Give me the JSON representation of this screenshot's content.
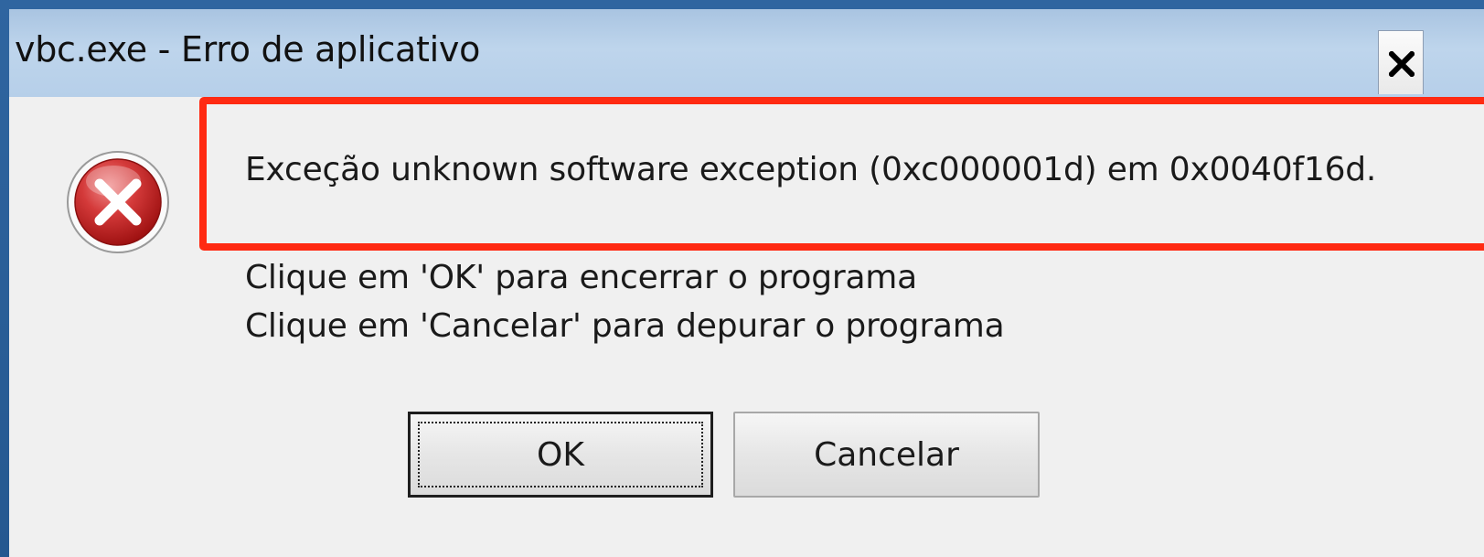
{
  "window": {
    "title": "vbc.exe - Erro de aplicativo",
    "close_glyph": "close-icon"
  },
  "message": {
    "icon": "error-icon",
    "main": "Exceção unknown software exception (0xc000001d) em 0x0040f16d.",
    "line1": "Clique em 'OK' para encerrar o programa",
    "line2": "Clique em 'Cancelar' para depurar o programa"
  },
  "buttons": {
    "ok": "OK",
    "cancel": "Cancelar"
  },
  "colors": {
    "highlight": "#ff2a12",
    "titlebar": "#b6cfe9",
    "error_red": "#c41e1e",
    "desktop_border": "#295c93"
  }
}
